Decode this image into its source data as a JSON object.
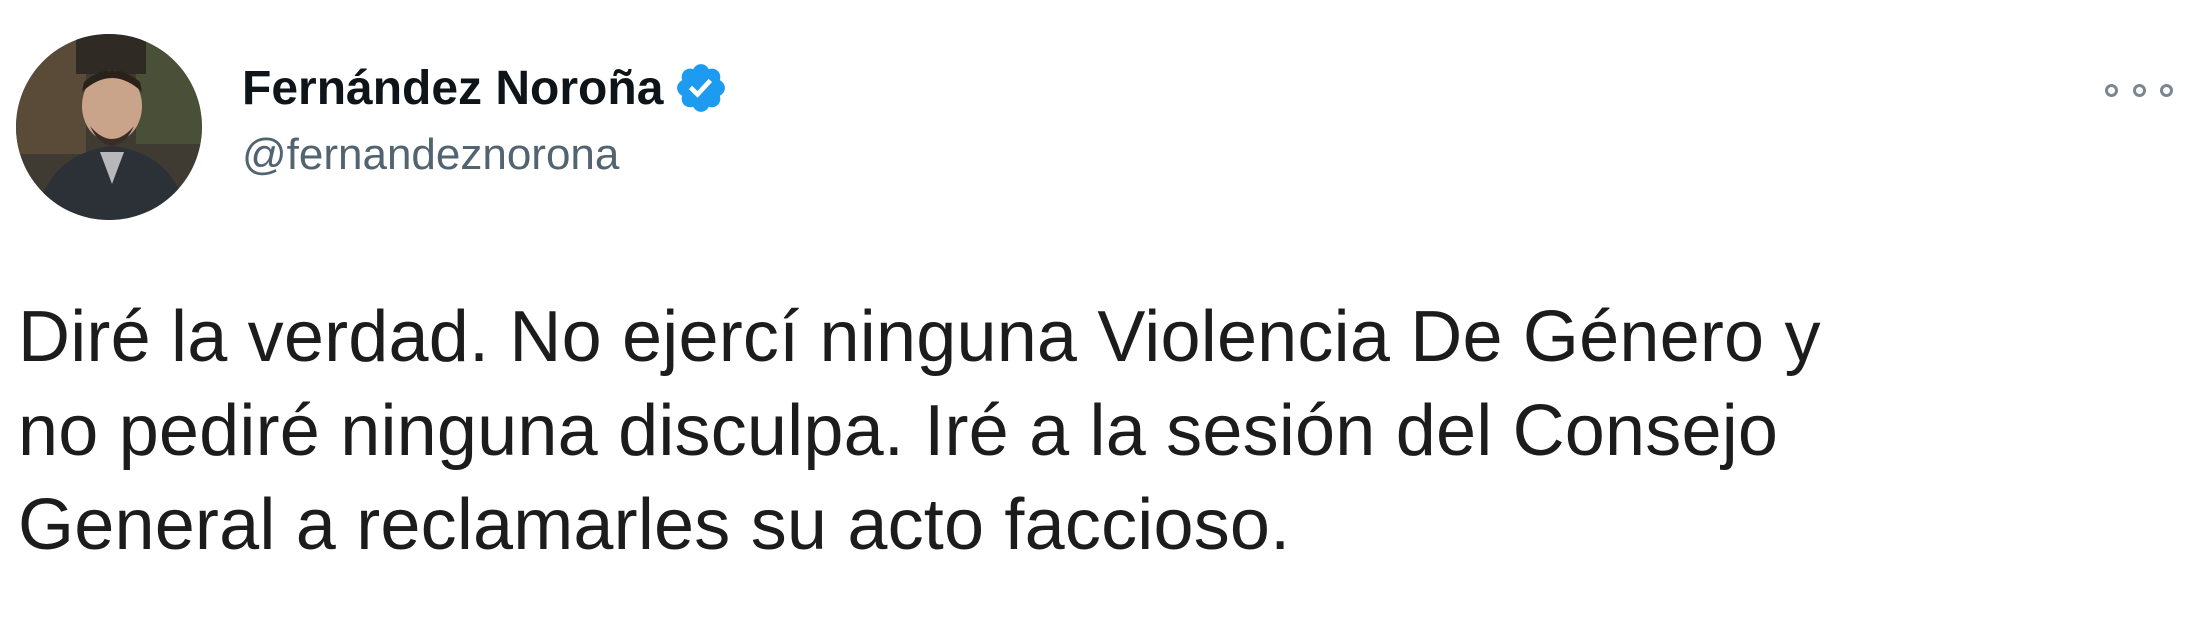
{
  "author": {
    "display_name": "Fernández Noroña",
    "handle": "@fernandeznorona",
    "verified": true
  },
  "tweet": {
    "lines": [
      "Diré la verdad. No ejercí ninguna Violencia De Género y",
      "no pediré ninguna disculpa. Iré a la sesión del Consejo",
      "General a reclamarles su acto faccioso."
    ]
  },
  "icons": {
    "avatar": "profile-photo",
    "verified": "verified-badge-icon",
    "more": "more-options-icon"
  },
  "colors": {
    "verified_blue": "#1d9bf0",
    "text": "#0f1419",
    "secondary_text": "#536471"
  }
}
